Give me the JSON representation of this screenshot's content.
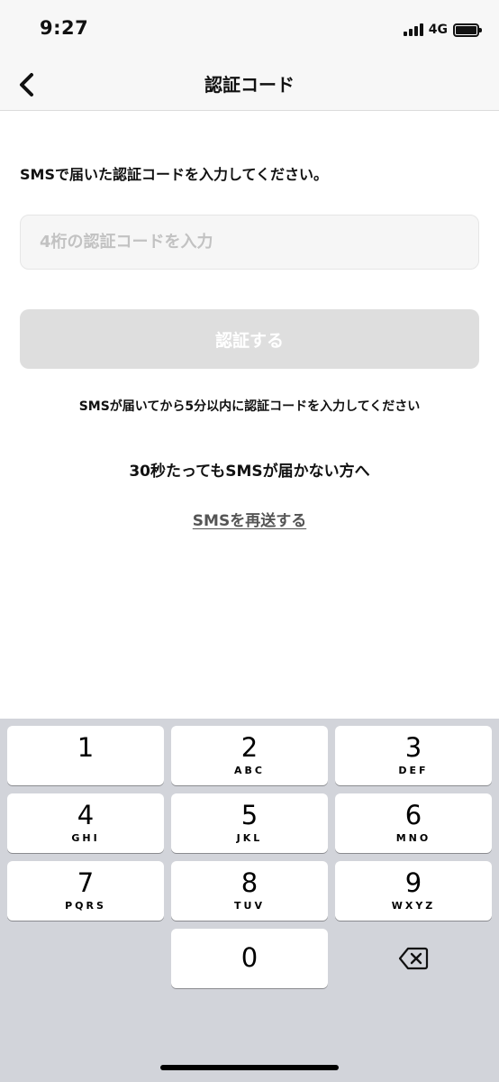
{
  "status_bar": {
    "time": "9:27",
    "network": "4G",
    "icons": [
      "signal-icon",
      "battery-icon"
    ]
  },
  "nav": {
    "title": "認証コード",
    "back_icon": "chevron-left-icon"
  },
  "main": {
    "instruction": "SMSで届いた認証コードを入力してください。",
    "code_input": {
      "value": "",
      "placeholder": "4桁の認証コードを入力"
    },
    "verify_button_label": "認証する",
    "hint": "SMSが届いてから5分以内に認証コードを入力してください",
    "no_sms_label": "30秒たってもSMSが届かない方へ",
    "resend_link": "SMSを再送する"
  },
  "keyboard": {
    "keys": [
      {
        "digit": "1",
        "letters": ""
      },
      {
        "digit": "2",
        "letters": "ABC"
      },
      {
        "digit": "3",
        "letters": "DEF"
      },
      {
        "digit": "4",
        "letters": "GHI"
      },
      {
        "digit": "5",
        "letters": "JKL"
      },
      {
        "digit": "6",
        "letters": "MNO"
      },
      {
        "digit": "7",
        "letters": "PQRS"
      },
      {
        "digit": "8",
        "letters": "TUV"
      },
      {
        "digit": "9",
        "letters": "WXYZ"
      },
      {
        "digit": "0",
        "letters": ""
      }
    ],
    "delete_icon": "backspace-icon"
  },
  "colors": {
    "keyboard_bg": "#d2d4da",
    "disabled_button": "#dedede",
    "link": "#555555"
  }
}
